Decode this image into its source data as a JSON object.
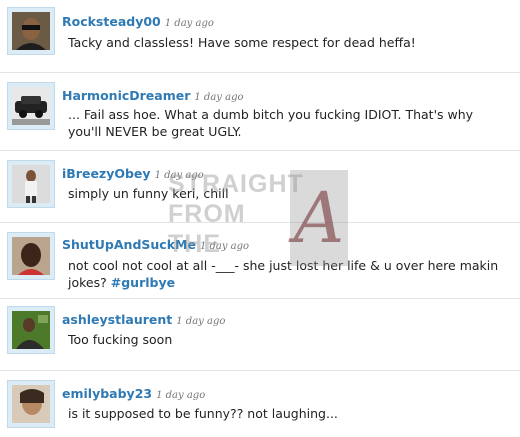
{
  "tweets": [
    {
      "username": "Rocksteady00",
      "time": "1 day ago",
      "text": "Tacky and classless! Have some respect for dead heffa!"
    },
    {
      "username": "HarmonicDreamer",
      "time": "1 day ago",
      "text": "... Fail ass hoe. What a dumb bitch you fucking IDIOT. That's why you'll NEVER be great UGLY."
    },
    {
      "username": "iBreezyObey",
      "time": "1 day ago",
      "text": "simply un funny keri, chill"
    },
    {
      "username": "ShutUpAndSuckMe",
      "time": "1 day ago",
      "text": "not cool not cool at all -___- she just lost her life & u over here makin jokes?",
      "hashtag": "#gurlbye"
    },
    {
      "username": "ashleystlaurent",
      "time": "1 day ago",
      "text": "Too fucking soon"
    },
    {
      "username": "emilybaby23",
      "time": "1 day ago",
      "text": "is it supposed to be funny?? not laughing..."
    }
  ],
  "watermark": {
    "line1": "STRAIGHT",
    "line2": "FROM",
    "line3": "THE",
    "letter": "A"
  },
  "colors": {
    "username": "#2f7ab4",
    "avatar_frame": "#dcecf7",
    "text": "#222222"
  },
  "avatar_icons": [
    "person-photo-icon",
    "car-photo-icon",
    "person-photo-icon",
    "person-photo-icon",
    "person-photo-icon",
    "person-photo-icon"
  ]
}
